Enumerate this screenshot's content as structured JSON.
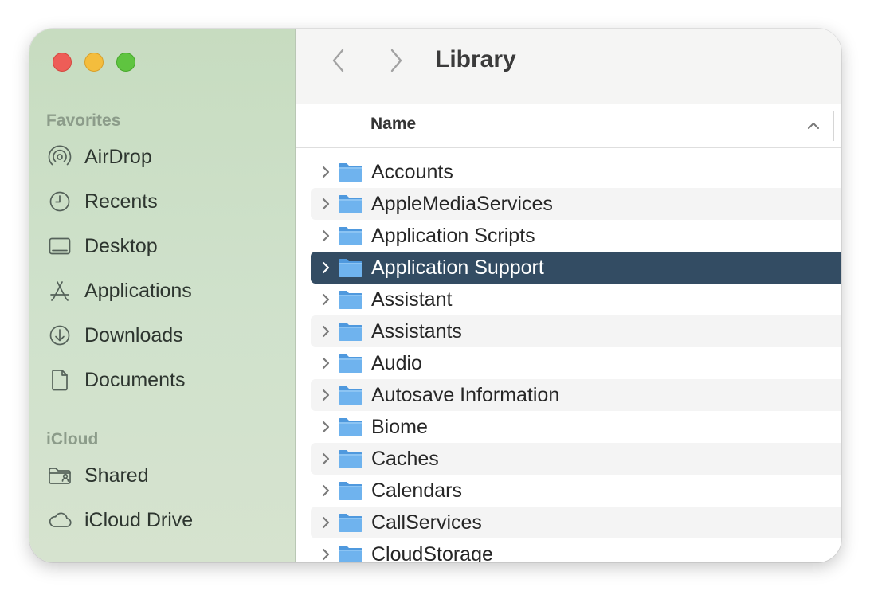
{
  "sidebar": {
    "favorites_heading": "Favorites",
    "favorites": [
      {
        "label": "AirDrop",
        "icon": "airdrop-icon"
      },
      {
        "label": "Recents",
        "icon": "clock-icon"
      },
      {
        "label": "Desktop",
        "icon": "desktop-icon"
      },
      {
        "label": "Applications",
        "icon": "applications-icon"
      },
      {
        "label": "Downloads",
        "icon": "download-icon"
      },
      {
        "label": "Documents",
        "icon": "document-icon"
      }
    ],
    "icloud_heading": "iCloud",
    "icloud": [
      {
        "label": "Shared",
        "icon": "shared-folder-icon"
      },
      {
        "label": "iCloud Drive",
        "icon": "cloud-icon"
      }
    ]
  },
  "toolbar": {
    "title": "Library",
    "back_icon": "chevron-left-icon",
    "forward_icon": "chevron-right-icon"
  },
  "list_header": {
    "name_column": "Name",
    "sort_icon": "chevron-up-icon"
  },
  "folders": [
    {
      "name": "Accounts",
      "selected": false
    },
    {
      "name": "AppleMediaServices",
      "selected": false
    },
    {
      "name": "Application Scripts",
      "selected": false
    },
    {
      "name": "Application Support",
      "selected": true
    },
    {
      "name": "Assistant",
      "selected": false
    },
    {
      "name": "Assistants",
      "selected": false
    },
    {
      "name": "Audio",
      "selected": false
    },
    {
      "name": "Autosave Information",
      "selected": false
    },
    {
      "name": "Biome",
      "selected": false
    },
    {
      "name": "Caches",
      "selected": false
    },
    {
      "name": "Calendars",
      "selected": false
    },
    {
      "name": "CallServices",
      "selected": false
    },
    {
      "name": "CloudStorage",
      "selected": false
    }
  ],
  "colors": {
    "selection": "#334c63",
    "folder_fill": "#6fb3ee",
    "traffic_close": "#ee5d57",
    "traffic_minimize": "#f4bd3d",
    "traffic_zoom": "#5fc440"
  }
}
